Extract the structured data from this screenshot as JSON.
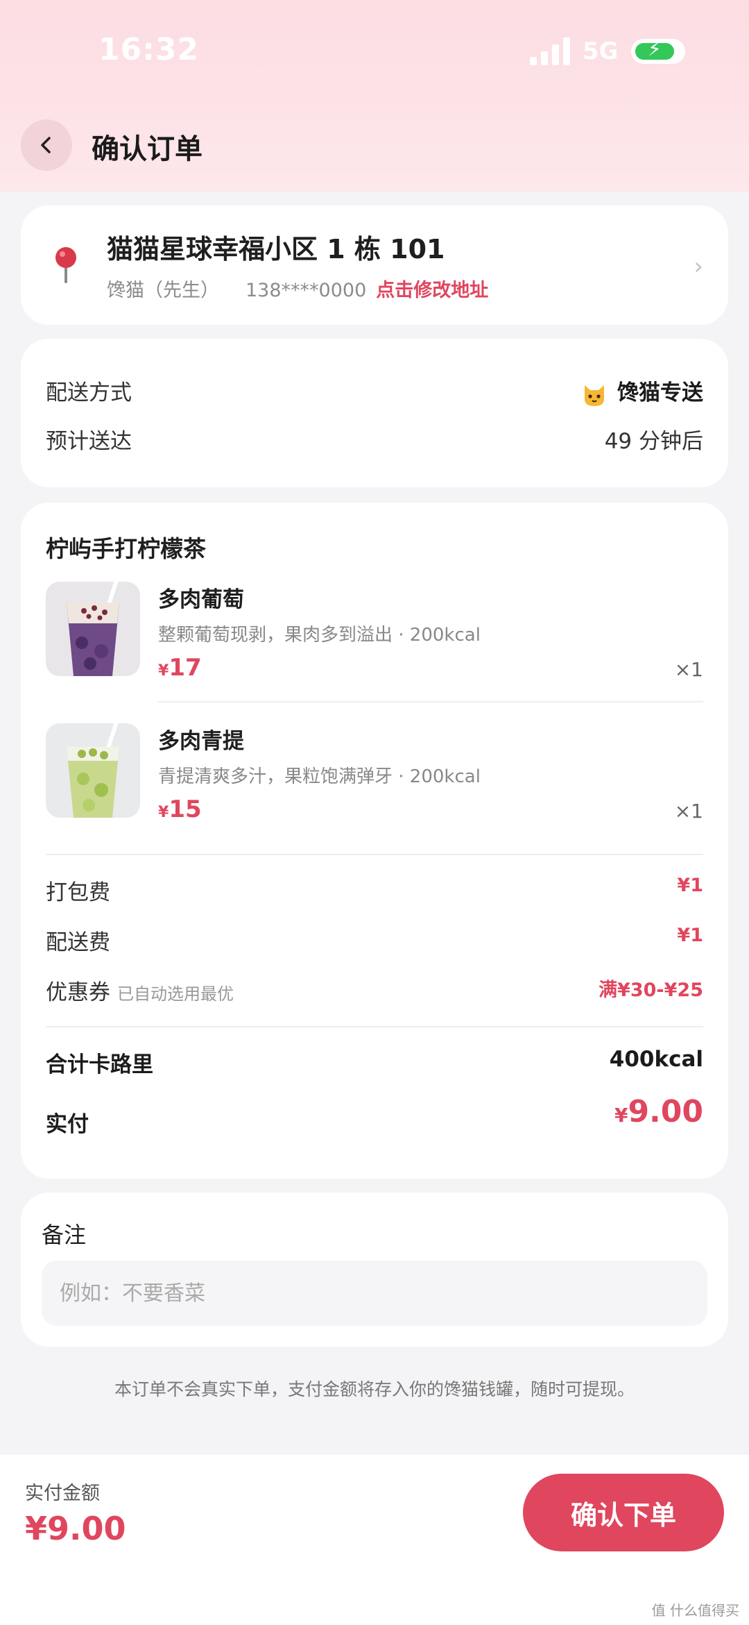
{
  "status_bar": {
    "time": "16:32",
    "network": "5G"
  },
  "header": {
    "title": "确认订单"
  },
  "address": {
    "line": "猫猫星球幸福小区 1 栋 101",
    "name": "馋猫（先生）",
    "phone": "138****0000",
    "edit_label": "点击修改地址"
  },
  "delivery": {
    "method_label": "配送方式",
    "method_value": "馋猫专送",
    "eta_label": "预计送达",
    "eta_value": "49 分钟后"
  },
  "order": {
    "shop": "柠屿手打柠檬茶",
    "items": [
      {
        "name": "多肉葡萄",
        "desc": "整颗葡萄现剥，果肉多到溢出 · 200kcal",
        "currency": "¥",
        "price": "17",
        "qty": "×1"
      },
      {
        "name": "多肉青提",
        "desc": "青提清爽多汁，果粒饱满弹牙 · 200kcal",
        "currency": "¥",
        "price": "15",
        "qty": "×1"
      }
    ],
    "fees": {
      "packing_label": "打包费",
      "packing_value": "¥1",
      "delivery_label": "配送费",
      "delivery_value": "¥1",
      "coupon_label": "优惠券",
      "coupon_note": "已自动选用最优",
      "coupon_value": "满¥30-¥25"
    },
    "calories_label": "合计卡路里",
    "calories_value": "400kcal",
    "paid_label": "实付",
    "paid_currency": "¥",
    "paid_value": "9.00"
  },
  "remark": {
    "title": "备注",
    "placeholder": "例如：不要香菜"
  },
  "notice": "本订单不会真实下单，支付金额将存入你的馋猫钱罐，随时可提现。",
  "bottom_bar": {
    "pay_label": "实付金额",
    "pay_value": "¥9.00",
    "confirm_label": "确认下单"
  },
  "watermark": "值 什么值得买",
  "colors": {
    "accent": "#e0465e",
    "header_bg": "#fbdde2",
    "page_bg": "#f4f4f6"
  }
}
